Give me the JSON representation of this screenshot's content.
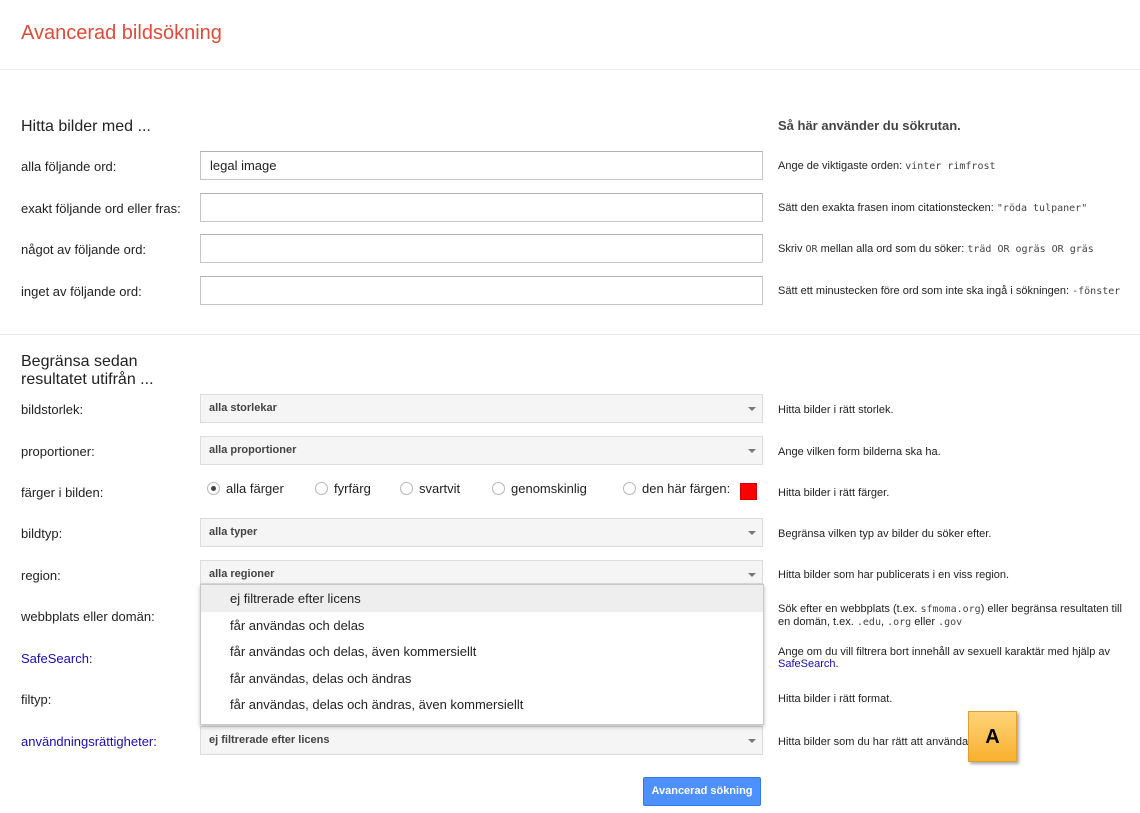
{
  "page": {
    "title": "Avancerad bildsökning"
  },
  "find_section": {
    "heading": "Hitta bilder med ...",
    "help_heading": "Så här använder du sökrutan.",
    "fields": [
      {
        "label": "alla följande ord:",
        "value": "legal image",
        "help_text": "Ange de viktigaste orden: ",
        "help_example": "vinter rimfrost"
      },
      {
        "label": "exakt följande ord eller fras:",
        "value": "",
        "help_text": "Sätt den exakta frasen inom citationstecken: ",
        "help_example": "\"röda tulpaner\""
      },
      {
        "label": "något av följande ord:",
        "value": "",
        "help_text": "Skriv ",
        "help_or": "OR",
        "help_text2": " mellan alla ord som du söker: ",
        "help_example": "träd OR ogräs OR gräs"
      },
      {
        "label": "inget av följande ord:",
        "value": "",
        "help_text": "Sätt ett minustecken före ord som inte ska ingå i sökningen: ",
        "help_example": "-fönster"
      }
    ]
  },
  "narrow_section": {
    "heading_line1": "Begränsa sedan",
    "heading_line2": "resultatet utifrån ...",
    "size": {
      "label": "bildstorlek:",
      "selected": "alla storlekar",
      "help": "Hitta bilder i rätt storlek."
    },
    "aspect": {
      "label": "proportioner:",
      "selected": "alla proportioner",
      "help": "Ange vilken form bilderna ska ha."
    },
    "colors": {
      "label": "färger i bilden:",
      "options": [
        "alla färger",
        "fyrfärg",
        "svartvit",
        "genomskinlig",
        "den här färgen:"
      ],
      "selected_index": 0,
      "swatch_color": "#ff0000",
      "help": "Hitta bilder i rätt färger."
    },
    "type": {
      "label": "bildtyp:",
      "selected": "alla typer",
      "help": "Begränsa vilken typ av bilder du söker efter."
    },
    "region": {
      "label": "region:",
      "selected": "alla regioner",
      "help": "Hitta bilder som har publicerats i en viss region."
    },
    "site": {
      "label": "webbplats eller domän:",
      "help_a": "Sök efter en webbplats (t.ex. ",
      "help_mono1": "sfmoma.org",
      "help_b": ") eller begränsa resultaten till en domän, t.ex. ",
      "help_mono2": ".edu",
      "help_c": ", ",
      "help_mono3": ".org",
      "help_d": " eller ",
      "help_mono4": ".gov"
    },
    "safesearch": {
      "label": "SafeSearch:",
      "help": "Ange om du vill filtrera bort innehåll av sexuell karaktär med hjälp av ",
      "help_link": "SafeSearch",
      "help_end": "."
    },
    "filetype": {
      "label": "filtyp:",
      "help": "Hitta bilder i rätt format."
    },
    "rights": {
      "label": "användningsrättigheter:",
      "selected": "ej filtrerade efter licens",
      "help": "Hitta bilder som du har rätt att använda.",
      "options": [
        "ej filtrerade efter licens",
        "får användas och delas",
        "får användas och delas, även kommersiellt",
        "får användas, delas och ändras",
        "får användas, delas och ändras, även kommersiellt"
      ],
      "highlighted_index": 0
    }
  },
  "submit": {
    "label": "Avancerad sökning"
  },
  "annotation": {
    "label": "A"
  },
  "colors": {
    "title": "#dd4b39",
    "link": "#1a0dab",
    "button": "#4d90fe",
    "callout": "#f8b12d"
  }
}
